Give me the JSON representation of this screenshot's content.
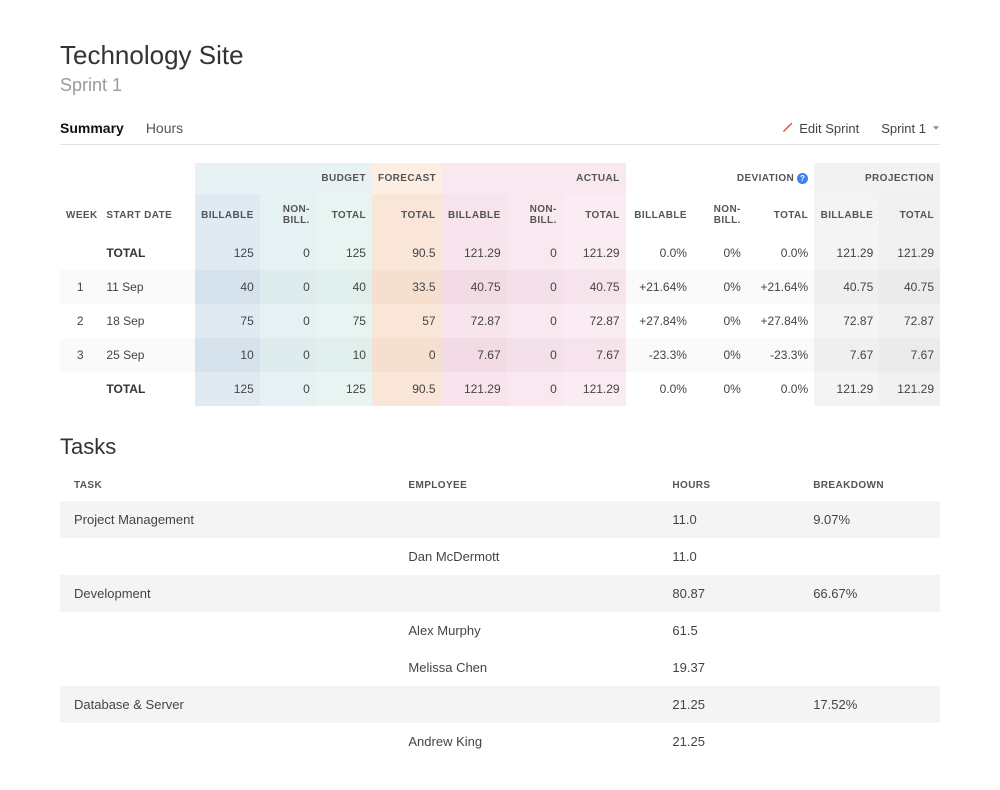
{
  "header": {
    "title": "Technology Site",
    "subtitle": "Sprint 1"
  },
  "tabs": {
    "summary": "Summary",
    "hours": "Hours",
    "active": "summary"
  },
  "actions": {
    "edit_sprint": "Edit Sprint",
    "sprint_select": "Sprint 1"
  },
  "table": {
    "groups": {
      "budget": "BUDGET",
      "forecast": "FORECAST",
      "actual": "ACTUAL",
      "deviation": "DEVIATION",
      "projection": "PROJECTION"
    },
    "cols": {
      "week": "WEEK",
      "start_date": "START DATE",
      "billable": "BILLABLE",
      "nonbill": "NON-BILL.",
      "total": "TOTAL"
    },
    "total_label": "TOTAL",
    "rows": [
      {
        "type": "total",
        "start": "TOTAL",
        "budget_b": "125",
        "budget_n": "0",
        "budget_t": "125",
        "forecast_t": "90.5",
        "actual_b": "121.29",
        "actual_n": "0",
        "actual_t": "121.29",
        "dev_b": "0.0%",
        "dev_n": "0%",
        "dev_t": "0.0%",
        "proj_b": "121.29",
        "proj_t": "121.29"
      },
      {
        "type": "week",
        "week": "1",
        "start": "11 Sep",
        "budget_b": "40",
        "budget_n": "0",
        "budget_t": "40",
        "forecast_t": "33.5",
        "actual_b": "40.75",
        "actual_n": "0",
        "actual_t": "40.75",
        "dev_b": "+21.64%",
        "dev_n": "0%",
        "dev_t": "+21.64%",
        "proj_b": "40.75",
        "proj_t": "40.75"
      },
      {
        "type": "week",
        "week": "2",
        "start": "18 Sep",
        "budget_b": "75",
        "budget_n": "0",
        "budget_t": "75",
        "forecast_t": "57",
        "actual_b": "72.87",
        "actual_n": "0",
        "actual_t": "72.87",
        "dev_b": "+27.84%",
        "dev_n": "0%",
        "dev_t": "+27.84%",
        "proj_b": "72.87",
        "proj_t": "72.87"
      },
      {
        "type": "week",
        "week": "3",
        "start": "25 Sep",
        "budget_b": "10",
        "budget_n": "0",
        "budget_t": "10",
        "forecast_t": "0",
        "actual_b": "7.67",
        "actual_n": "0",
        "actual_t": "7.67",
        "dev_b": "-23.3%",
        "dev_n": "0%",
        "dev_t": "-23.3%",
        "proj_b": "7.67",
        "proj_t": "7.67"
      },
      {
        "type": "total",
        "start": "TOTAL",
        "budget_b": "125",
        "budget_n": "0",
        "budget_t": "125",
        "forecast_t": "90.5",
        "actual_b": "121.29",
        "actual_n": "0",
        "actual_t": "121.29",
        "dev_b": "0.0%",
        "dev_n": "0%",
        "dev_t": "0.0%",
        "proj_b": "121.29",
        "proj_t": "121.29"
      }
    ]
  },
  "tasks_heading": "Tasks",
  "tasks": {
    "cols": {
      "task": "TASK",
      "employee": "EMPLOYEE",
      "hours": "HOURS",
      "breakdown": "BREAKDOWN"
    },
    "rows": [
      {
        "type": "group",
        "task": "Project Management",
        "hours": "11.0",
        "breakdown": "9.07%"
      },
      {
        "type": "emp",
        "employee": "Dan McDermott",
        "hours": "11.0"
      },
      {
        "type": "group",
        "task": "Development",
        "hours": "80.87",
        "breakdown": "66.67%"
      },
      {
        "type": "emp",
        "employee": "Alex Murphy",
        "hours": "61.5"
      },
      {
        "type": "emp",
        "employee": "Melissa Chen",
        "hours": "19.37"
      },
      {
        "type": "group",
        "task": "Database & Server",
        "hours": "21.25",
        "breakdown": "17.52%"
      },
      {
        "type": "emp",
        "employee": "Andrew King",
        "hours": "21.25"
      }
    ]
  }
}
